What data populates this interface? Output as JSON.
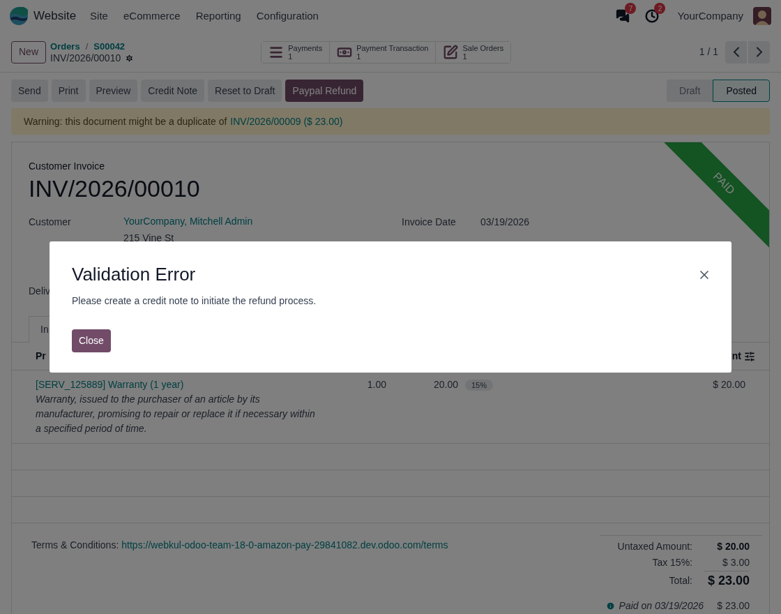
{
  "navbar": {
    "app": "Website",
    "menus": [
      "Site",
      "eCommerce",
      "Reporting",
      "Configuration"
    ],
    "messages_badge": "7",
    "activities_badge": "2",
    "company": "YourCompany"
  },
  "control_panel": {
    "new_button": "New",
    "breadcrumbs": [
      "Orders",
      "S00042"
    ],
    "breadcrumb_separator": "/",
    "record": "INV/2026/00010",
    "smart_buttons": [
      {
        "label": "Payments",
        "count": "1",
        "kind": "list"
      },
      {
        "label": "Payment Transaction",
        "count": "1",
        "kind": "money"
      },
      {
        "label": "Sale Orders",
        "count": "1",
        "kind": "edit"
      }
    ],
    "pager": "1 / 1"
  },
  "actions": [
    {
      "label": "Send",
      "primary": false
    },
    {
      "label": "Print",
      "primary": false
    },
    {
      "label": "Preview",
      "primary": false
    },
    {
      "label": "Credit Note",
      "primary": false
    },
    {
      "label": "Reset to Draft",
      "primary": false
    },
    {
      "label": "Paypal Refund",
      "primary": true
    }
  ],
  "status_bar": [
    {
      "label": "Draft",
      "selected": false
    },
    {
      "label": "Posted",
      "selected": true
    }
  ],
  "warning": {
    "text": "Warning: this document might be a duplicate of",
    "link": "INV/2026/00009 ($ 23.00)"
  },
  "invoice": {
    "type": "Customer Invoice",
    "number": "INV/2026/00010",
    "ribbon": "PAID",
    "customer_label": "Customer",
    "customer": "YourCompany, Mitchell Admin",
    "address": "215 Vine St",
    "date_label": "Invoice Date",
    "date": "03/19/2026",
    "delivery_label": "Deliv",
    "tab": "In",
    "columns": [
      "Pr",
      "nt"
    ],
    "lines": [
      {
        "product": "[SERV_125889] Warranty (1 year)",
        "description": "Warranty, issued to the purchaser of an article by its manufacturer, promising to repair or replace it if necessary within a specified period of time.",
        "quantity": "1.00",
        "price": "20.00",
        "tax": "15%",
        "amount": "$ 20.00"
      }
    ],
    "terms_label": "Terms & Conditions:",
    "terms_url": "https://webkul-odoo-team-18-0-amazon-pay-29841082.dev.odoo.com/terms",
    "totals": [
      {
        "label": "Untaxed Amount:",
        "value": "$ 20.00",
        "kind": "bold"
      },
      {
        "label": "Tax 15%:",
        "value": "$ 3.00",
        "kind": "plain"
      },
      {
        "label": "Total:",
        "value": "$ 23.00",
        "kind": "grand"
      }
    ],
    "payment": {
      "label": "Paid on 03/19/2026",
      "amount": "$ 23.00"
    }
  },
  "dialog": {
    "title": "Validation Error",
    "message": "Please create a credit note to initiate the refund process.",
    "button": "Close"
  }
}
